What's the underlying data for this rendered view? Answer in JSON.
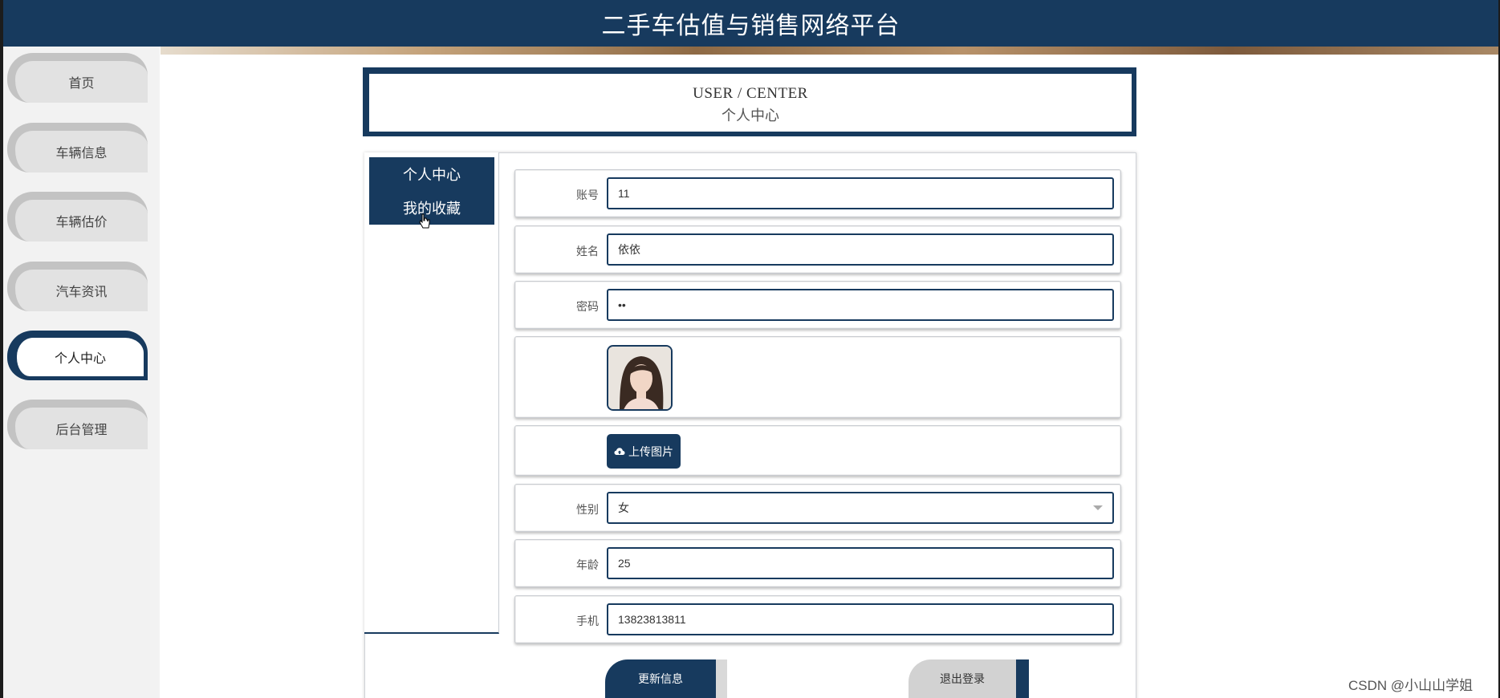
{
  "header": {
    "title": "二手车估值与销售网络平台"
  },
  "sidebar": {
    "items": [
      {
        "label": "首页"
      },
      {
        "label": "车辆信息"
      },
      {
        "label": "车辆估价"
      },
      {
        "label": "汽车资讯"
      },
      {
        "label": "个人中心",
        "active": true
      },
      {
        "label": "后台管理"
      }
    ]
  },
  "title_box": {
    "en": "USER / CENTER",
    "cn": "个人中心"
  },
  "tabs": [
    {
      "label": "个人中心"
    },
    {
      "label": "我的收藏"
    }
  ],
  "form": {
    "account": {
      "label": "账号",
      "value": "11"
    },
    "name": {
      "label": "姓名",
      "value": "依依"
    },
    "password": {
      "label": "密码",
      "value": "••"
    },
    "upload_button": "上传图片",
    "gender": {
      "label": "性别",
      "value": "女"
    },
    "age": {
      "label": "年龄",
      "value": "25"
    },
    "phone": {
      "label": "手机",
      "value": "13823813811"
    }
  },
  "buttons": {
    "update": "更新信息",
    "logout": "退出登录"
  },
  "watermark": "CSDN @小山山学姐",
  "colors": {
    "primary": "#173a5e",
    "sidebar_bg": "#f2f2f2",
    "nav_inactive": "#e2e2e2"
  }
}
